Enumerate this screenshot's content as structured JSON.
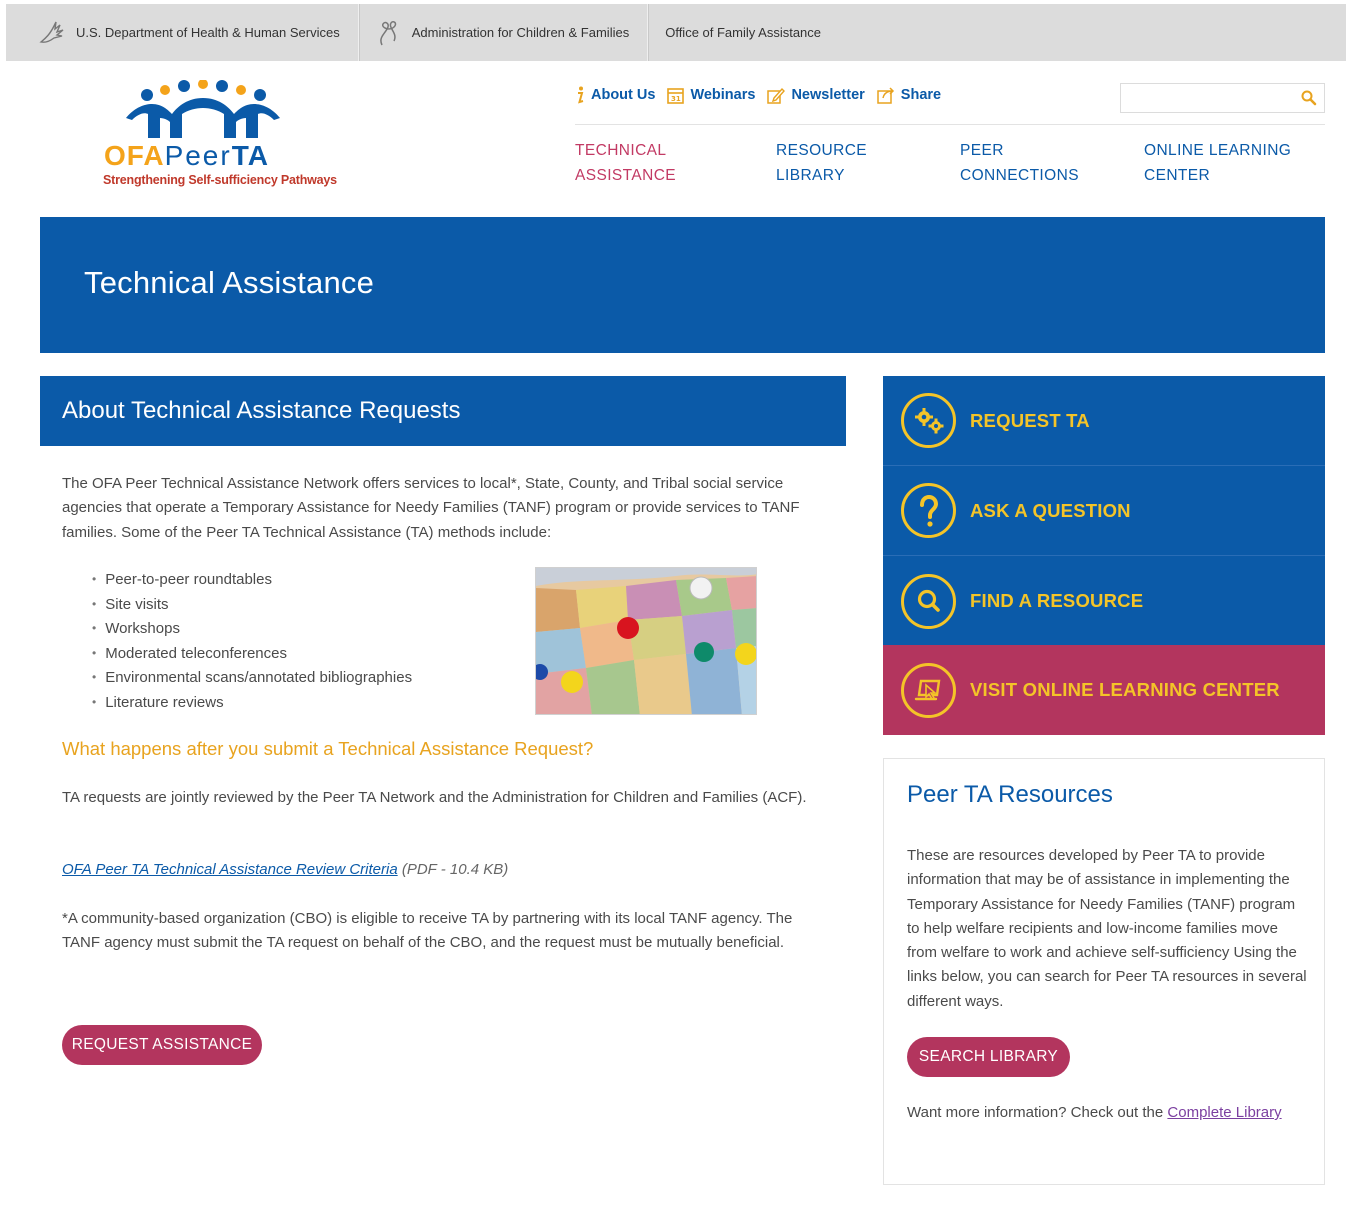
{
  "govbar": {
    "hhs": "U.S. Department of Health & Human Services",
    "acf": "Administration for Children & Families",
    "ofa": "Office of Family Assistance"
  },
  "logo": {
    "ofa": "OFA",
    "peer": "Peer",
    "ta": "TA",
    "tagline": "Strengthening Self-sufficiency Pathways"
  },
  "utility": {
    "about": "About Us",
    "webinars": "Webinars",
    "newsletter": "Newsletter",
    "share": "Share"
  },
  "search": {
    "placeholder": ""
  },
  "nav": {
    "technical_1": "TECHNICAL",
    "technical_2": "ASSISTANCE",
    "resource_1": "RESOURCE",
    "resource_2": "LIBRARY",
    "peer_1": "PEER",
    "peer_2": "CONNECTIONS",
    "online_1": "ONLINE LEARNING",
    "online_2": "CENTER"
  },
  "banner": {
    "title": "Technical Assistance"
  },
  "main": {
    "section_title": "About Technical Assistance Requests",
    "intro": "The OFA Peer Technical Assistance Network offers services to local*, State, County, and Tribal social service agencies that operate a Temporary Assistance for Needy Families (TANF) program or provide services to TANF families. Some of the Peer TA Technical Assistance (TA) methods include:",
    "methods": [
      "Peer-to-peer roundtables",
      "Site visits",
      "Workshops",
      "Moderated teleconferences",
      "Environmental scans/annotated bibliographies",
      "Literature reviews"
    ],
    "subhead": "What happens after you submit a Technical Assistance Request?",
    "review": "TA requests are jointly reviewed by the Peer TA Network and the Administration for Children and Families (ACF).",
    "criteria_link": "OFA Peer TA Technical Assistance Review Criteria",
    "criteria_meta": " (PDF - 10.4 KB)",
    "cbo": "*A community-based organization (CBO) is eligible to receive TA by partnering with its local TANF agency. The TANF agency must submit the TA request on behalf of the CBO, and the request must be mutually beneficial.",
    "request_button": "REQUEST ASSISTANCE"
  },
  "sidebar": {
    "cta_request": "REQUEST TA",
    "cta_ask": "ASK A QUESTION",
    "cta_find": "FIND A RESOURCE",
    "cta_visit": "VISIT ONLINE LEARNING CENTER",
    "res_title": "Peer TA Resources",
    "res_text": "These are resources developed by Peer TA to provide information that may be of assistance in implementing the Temporary Assistance for Needy Families (TANF) program to help welfare recipients and low-income families move from welfare to work and achieve self-sufficiency Using the links below, you can search for Peer TA resources in several different ways.",
    "search_button": "SEARCH LIBRARY",
    "more_prefix": "Want more information? Check out the ",
    "more_link": "Complete Library"
  },
  "colors": {
    "brand_blue": "#0b5aa8",
    "accent_magenta": "#b3355e",
    "accent_gold": "#f4c428",
    "subhead_orange": "#e8a31f"
  }
}
